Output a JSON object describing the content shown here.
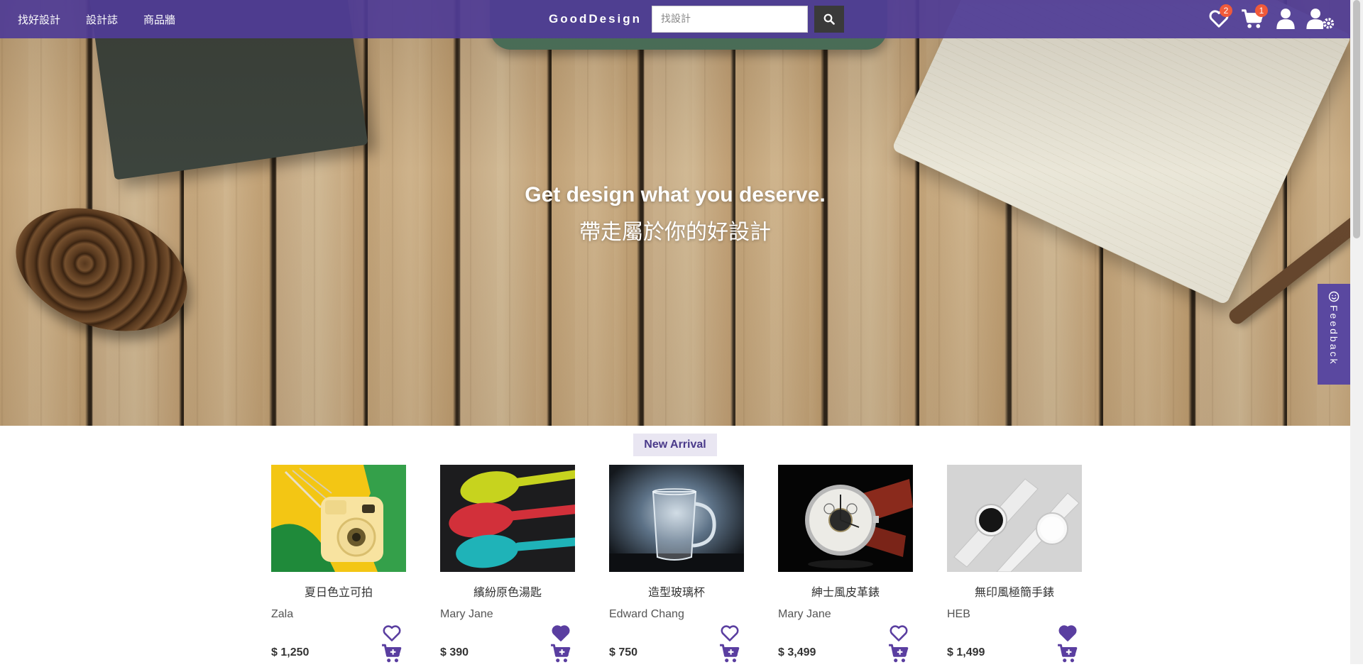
{
  "nav": {
    "links": [
      "找好設計",
      "設計誌",
      "商品牆"
    ],
    "brand": "GoodDesign",
    "search_placeholder": "找設計",
    "wishlist_count": "2",
    "cart_count": "1"
  },
  "hero": {
    "title": "Get design what you deserve.",
    "subtitle": "帶走屬於你的好設計"
  },
  "feedback": {
    "label": "Feedback"
  },
  "section": {
    "label": "New Arrival"
  },
  "products": [
    {
      "title": "夏日色立可拍",
      "designer": "Zala",
      "price": "$ 1,250",
      "favorited": false
    },
    {
      "title": "繽紛原色湯匙",
      "designer": "Mary Jane",
      "price": "$ 390",
      "favorited": true
    },
    {
      "title": "造型玻璃杯",
      "designer": "Edward Chang",
      "price": "$ 750",
      "favorited": false
    },
    {
      "title": "紳士風皮革錶",
      "designer": "Mary Jane",
      "price": "$ 3,499",
      "favorited": false
    },
    {
      "title": "無印風極簡手錶",
      "designer": "HEB",
      "price": "$ 1,499",
      "favorited": true
    }
  ],
  "colors": {
    "nav_bg": "#503c96",
    "accent": "#5a3ea0",
    "badge": "#f05a3a"
  }
}
